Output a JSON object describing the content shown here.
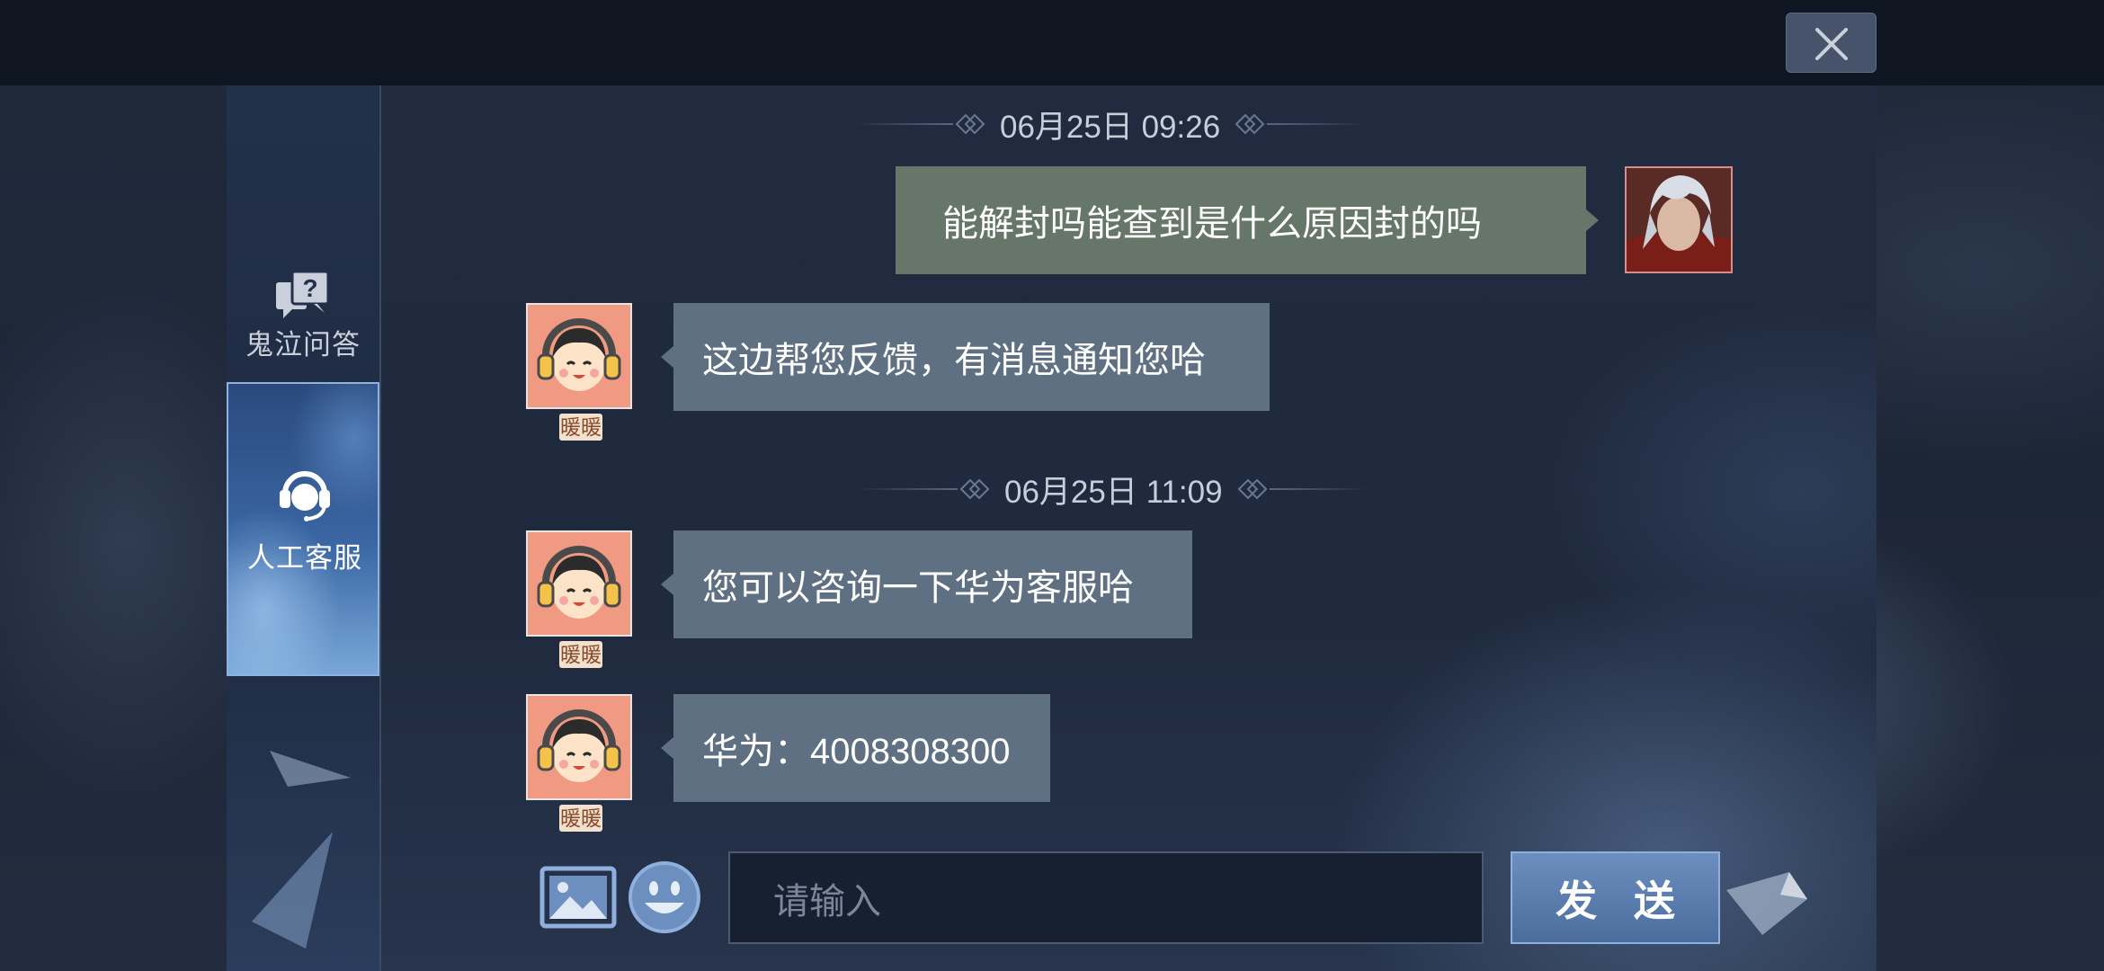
{
  "window": {
    "close_icon": "close-icon"
  },
  "sidebar": {
    "items": [
      {
        "label": "鬼泣问答",
        "icon": "question-bubble-icon",
        "active": false
      },
      {
        "label": "人工客服",
        "icon": "headset-icon",
        "active": true
      }
    ]
  },
  "chat": {
    "timestamps": [
      "06月25日 09:26",
      "06月25日 11:09"
    ],
    "messages": [
      {
        "sender": "user",
        "text": "能解封吗能查到是什么原因封的吗"
      },
      {
        "sender": "agent",
        "name": "暖暖",
        "text": "这边帮您反馈，有消息通知您哈"
      },
      {
        "sender": "agent",
        "name": "暖暖",
        "text": "您可以咨询一下华为客服哈"
      },
      {
        "sender": "agent",
        "name": "暖暖",
        "text": "华为：4008308300"
      }
    ]
  },
  "composer": {
    "placeholder": "请输入",
    "send_label": "发 送",
    "image_icon": "image-icon",
    "emoji_icon": "emoji-icon"
  },
  "colors": {
    "user_bubble": "#66776a",
    "agent_bubble": "#5f7083",
    "send_button": "#5b7dae"
  }
}
